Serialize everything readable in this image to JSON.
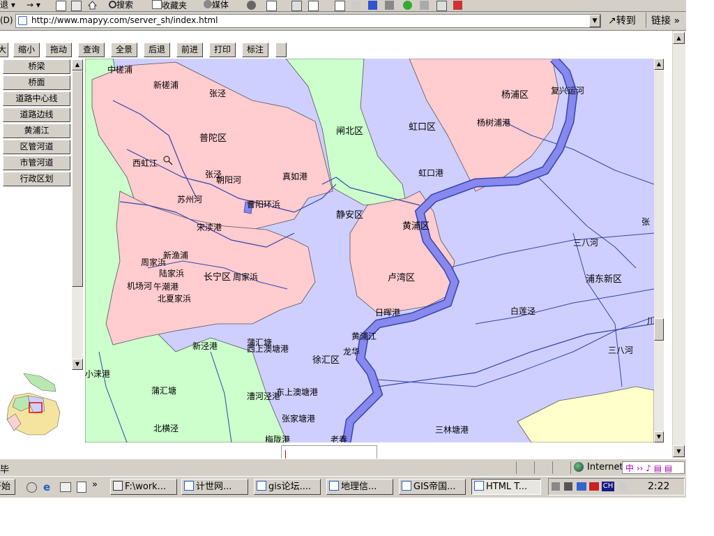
{
  "ie_toolbar": {
    "back_label": "退",
    "search_label": "搜索",
    "favorites_label": "收藏夹",
    "media_label": "媒体"
  },
  "address_bar": {
    "prefix": "(D)",
    "url": "http://www.mapyy.com/server_sh/index.html",
    "go_label": "转到",
    "links_label": "链接"
  },
  "map_toolbar": {
    "partial": "大",
    "zoom_out": "缩小",
    "pan": "拖动",
    "query": "查询",
    "full_view": "全景",
    "back": "后退",
    "forward": "前进",
    "print": "打印",
    "annotate": "标注"
  },
  "layers": [
    "桥梁",
    "桥面",
    "道路中心线",
    "道路边线",
    "黄浦江",
    "区管河道",
    "市管河道",
    "行政区划"
  ],
  "map_labels": {
    "zhongcaopu": "中槎浦",
    "xincaopu": "新槎浦",
    "zhangjing1": "张泾",
    "putuo": "普陀区",
    "zhabei": "闸北区",
    "hongkou": "虹口区",
    "yangpu": "杨浦区",
    "fuxing": "复兴运河",
    "yangshupu": "杨树浦港",
    "xihongjiang": "西虹江",
    "zhangjing2": "张泾",
    "chaoyanghe": "朝阳河",
    "zhenrugang": "真如港",
    "hongkougang": "虹口港",
    "suzhouhe": "苏州河",
    "caoyanghuanbang": "曹阳环浜",
    "jingan": "静安区",
    "huangpu": "黄浦区",
    "songdugang": "宋渎港",
    "xinyupu": "新渔浦",
    "zhoujiabang1": "周家浜",
    "lujiabang": "陆家浜",
    "changning": "长宁区",
    "zhoujiabang2": "周家浜",
    "jichanghe": "机场河",
    "wuchaogang": "午潮港",
    "beixiajiabang": "北夏家浜",
    "luwan": "卢湾区",
    "rihuigang": "日晖港",
    "baijiang": "白莲泾",
    "sanbahe1": "三八河",
    "pudong": "浦东新区",
    "zhang": "张",
    "chuan": "川",
    "huangpujiang": "黄浦江",
    "longhua": "龙华",
    "xinjinggang": "新泾港",
    "puhuitang1": "蒲汇塘",
    "xishangaotang": "西上澳塘港",
    "xuhui": "徐汇区",
    "sanbahe2": "三八河",
    "xiaolaigang": "小涞港",
    "puhuitang2": "蒲汇塘",
    "caohejing": "漕河泾港",
    "dongshangaotang": "东上澳塘港",
    "zhangjiatang": "张家塘港",
    "beihengjing": "北横泾",
    "meilonggang": "梅陇港",
    "laochun": "老春",
    "sanlintang": "三林塘港"
  },
  "status": {
    "done": "毕",
    "zone": "Internet"
  },
  "taskbar": {
    "start": "开始",
    "tasks": [
      "F:\\work...",
      "计世网...",
      "gis论坛....",
      "地理信...",
      "GIS帝国...",
      "HTML T..."
    ],
    "lang": "CH",
    "time": "2:22"
  },
  "colors": {
    "district_pink": "#ffccd0",
    "district_purple": "#cfcfff",
    "district_green": "#ccffcc",
    "district_yellow": "#ffffcc",
    "river_blue": "#8888ee",
    "chrome": "#d4d0c8"
  }
}
